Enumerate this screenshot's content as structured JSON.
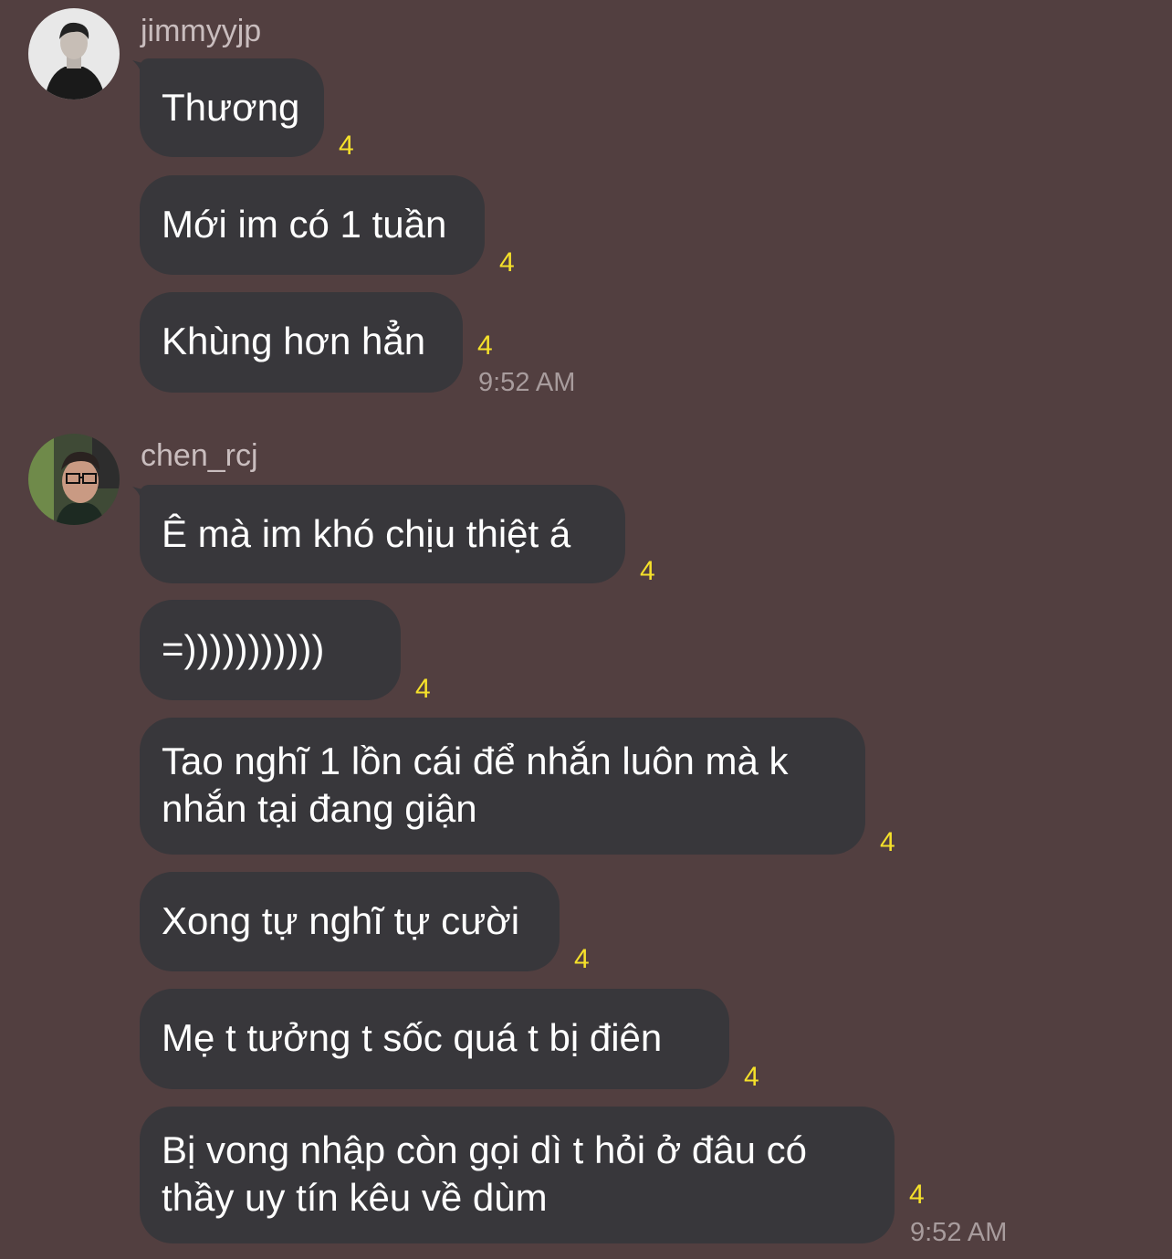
{
  "conversation": {
    "groups": [
      {
        "username": "jimmyyjp",
        "avatar_icon": "profile-photo-icon",
        "time": "9:52 AM",
        "messages": [
          {
            "text": "Thương",
            "count": "4"
          },
          {
            "text": "Mới im có 1 tuần",
            "count": "4"
          },
          {
            "text": "Khùng hơn hẳn",
            "count": "4"
          }
        ]
      },
      {
        "username": "chen_rcj",
        "avatar_icon": "profile-photo-icon",
        "time": "9:52 AM",
        "messages": [
          {
            "text": "Ê mà im khó chịu thiệt á",
            "count": "4"
          },
          {
            "text": "=)))))))))))",
            "count": "4"
          },
          {
            "text": "Tao nghĩ 1 lồn cái để nhắn luôn mà k nhắn tại đang giận",
            "count": "4"
          },
          {
            "text": "Xong tự nghĩ tự cười",
            "count": "4"
          },
          {
            "text": "Mẹ t tưởng t sốc quá t bị điên",
            "count": "4"
          },
          {
            "text": "Bị vong nhập còn gọi dì t hỏi ở đâu có thầy uy tín kêu về dùm",
            "count": "4"
          }
        ]
      }
    ],
    "colors": {
      "background": "#523f40",
      "bubble": "#38373b",
      "message_text": "#ffffff",
      "count_text": "#f5e12a",
      "meta_text": "#a89c9d"
    }
  }
}
